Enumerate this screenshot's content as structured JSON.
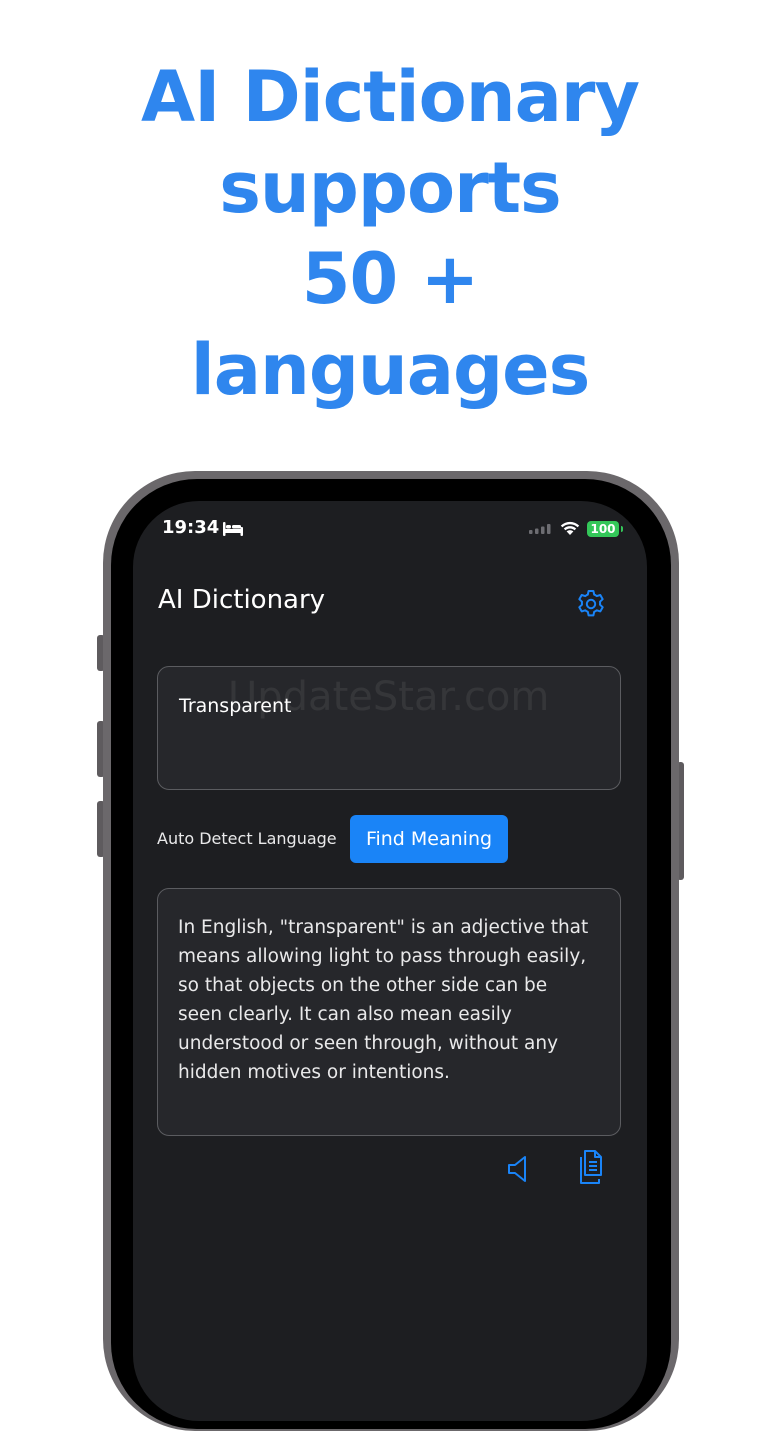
{
  "promo": {
    "line1": "AI Dictionary",
    "line2": "supports",
    "line3": "50 +",
    "line4": "languages"
  },
  "status_bar": {
    "time": "19:34",
    "battery": "100"
  },
  "app": {
    "title": "AI Dictionary"
  },
  "input": {
    "value": "Transparent"
  },
  "watermark": "UpdateStar.com",
  "controls": {
    "language_label": "Auto Detect Language",
    "find_button": "Find Meaning"
  },
  "result": {
    "lines": [
      "In English, \"transparent\" is an adjective that",
      "means allowing light to pass through easily,",
      "so that objects on the other side can be",
      "seen clearly. It can also mean easily",
      "understood or seen through, without any",
      "hidden motives or intentions."
    ]
  },
  "colors": {
    "accent": "#1a84f7",
    "promo_blue": "#2f86ee",
    "screen_bg": "#1d1e21",
    "battery_green": "#34c759"
  },
  "icons": {
    "settings": "gear-icon",
    "speaker": "speaker-icon",
    "copy": "copy-icon",
    "sleep": "bed-icon",
    "wifi": "wifi-icon",
    "signal": "signal-icon"
  }
}
